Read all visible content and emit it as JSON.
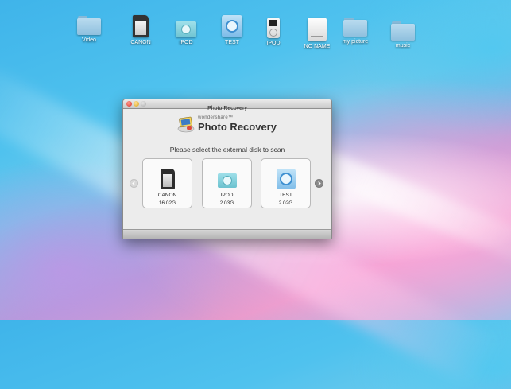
{
  "desktop": {
    "icons": [
      {
        "label": "Video",
        "icon": "folder-icon"
      },
      {
        "label": "CANON",
        "icon": "sd-card-icon"
      },
      {
        "label": "IPOD",
        "icon": "ipod-shuffle-icon"
      },
      {
        "label": "TEST",
        "icon": "ipod-square-icon"
      },
      {
        "label": "IPOD",
        "icon": "ipod-classic-icon"
      },
      {
        "label": "NO NAME",
        "icon": "external-drive-icon"
      },
      {
        "label": "my picture",
        "icon": "folder-icon"
      },
      {
        "label": "music",
        "icon": "folder-icon"
      }
    ]
  },
  "window": {
    "title": "Photo Recovery",
    "brand_small": "wondershare™",
    "brand_main": "Photo Recovery",
    "prompt": "Please select the external disk to scan",
    "disks": [
      {
        "name": "CANON",
        "size": "16.02G",
        "icon": "sd-card-icon"
      },
      {
        "name": "IPOD",
        "size": "2.03G",
        "icon": "ipod-shuffle-icon"
      },
      {
        "name": "TEST",
        "size": "2.02G",
        "icon": "ipod-square-icon"
      }
    ]
  },
  "colors": {
    "window_bg": "#ececec",
    "card_bg": "#fafafa",
    "close": "#d8322a",
    "minimize": "#d9a21c"
  }
}
